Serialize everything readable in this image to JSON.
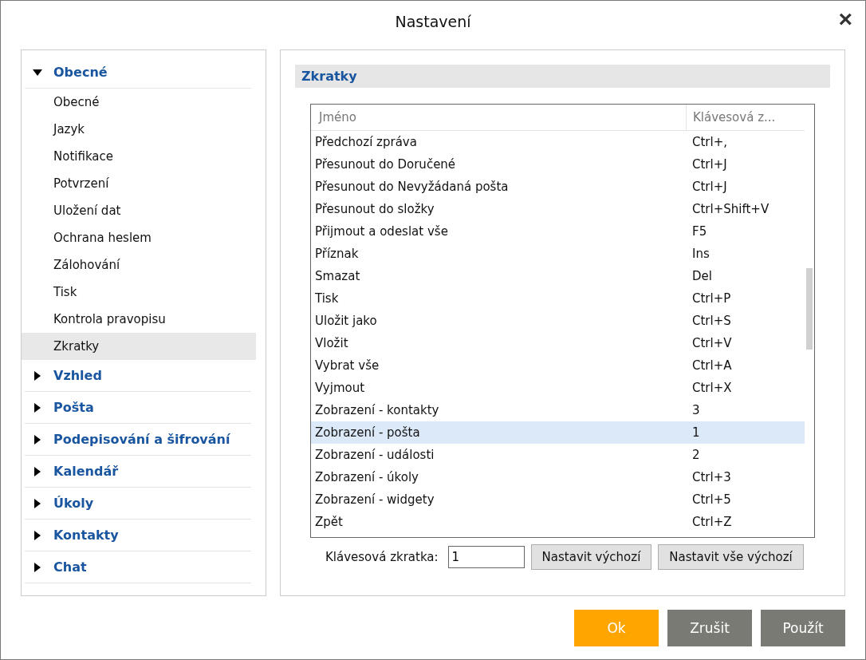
{
  "window": {
    "title": "Nastavení",
    "close": "×"
  },
  "sidebar": {
    "groups": [
      {
        "label": "Obecné",
        "expanded": true,
        "children": [
          {
            "label": "Obecné",
            "selected": false
          },
          {
            "label": "Jazyk",
            "selected": false
          },
          {
            "label": "Notifikace",
            "selected": false
          },
          {
            "label": "Potvrzení",
            "selected": false
          },
          {
            "label": "Uložení dat",
            "selected": false
          },
          {
            "label": "Ochrana heslem",
            "selected": false
          },
          {
            "label": "Zálohování",
            "selected": false
          },
          {
            "label": "Tisk",
            "selected": false
          },
          {
            "label": "Kontrola pravopisu",
            "selected": false
          },
          {
            "label": "Zkratky",
            "selected": true
          }
        ]
      },
      {
        "label": "Vzhled",
        "expanded": false
      },
      {
        "label": "Pošta",
        "expanded": false
      },
      {
        "label": "Podepisování a šifrování",
        "expanded": false
      },
      {
        "label": "Kalendář",
        "expanded": false
      },
      {
        "label": "Úkoly",
        "expanded": false
      },
      {
        "label": "Kontakty",
        "expanded": false
      },
      {
        "label": "Chat",
        "expanded": false
      }
    ]
  },
  "section": {
    "title": "Zkratky"
  },
  "table": {
    "columns": [
      "Jméno",
      "Klávesová z..."
    ],
    "rows": [
      {
        "name": "Předchozí zpráva",
        "key": "Ctrl+,",
        "selected": false
      },
      {
        "name": "Přesunout do Doručené",
        "key": "Ctrl+J",
        "selected": false
      },
      {
        "name": "Přesunout do Nevyžádaná pošta",
        "key": "Ctrl+J",
        "selected": false
      },
      {
        "name": "Přesunout do složky",
        "key": "Ctrl+Shift+V",
        "selected": false
      },
      {
        "name": "Přijmout a odeslat vše",
        "key": "F5",
        "selected": false
      },
      {
        "name": "Příznak",
        "key": "Ins",
        "selected": false
      },
      {
        "name": "Smazat",
        "key": "Del",
        "selected": false
      },
      {
        "name": "Tisk",
        "key": "Ctrl+P",
        "selected": false
      },
      {
        "name": "Uložit jako",
        "key": "Ctrl+S",
        "selected": false
      },
      {
        "name": "Vložit",
        "key": "Ctrl+V",
        "selected": false
      },
      {
        "name": "Vybrat vše",
        "key": "Ctrl+A",
        "selected": false
      },
      {
        "name": "Vyjmout",
        "key": "Ctrl+X",
        "selected": false
      },
      {
        "name": "Zobrazení - kontakty",
        "key": "3",
        "selected": false
      },
      {
        "name": "Zobrazení - pošta",
        "key": "1",
        "selected": true
      },
      {
        "name": "Zobrazení - události",
        "key": "2",
        "selected": false
      },
      {
        "name": "Zobrazení - úkoly",
        "key": "Ctrl+3",
        "selected": false
      },
      {
        "name": "Zobrazení - widgety",
        "key": "Ctrl+5",
        "selected": false
      },
      {
        "name": "Zpět",
        "key": "Ctrl+Z",
        "selected": false
      }
    ]
  },
  "shortcut": {
    "label": "Klávesová zkratka:",
    "value": "1",
    "buttons": [
      "Nastavit výchozí",
      "Nastavit vše výchozí"
    ]
  },
  "footer": [
    {
      "label": "Ok",
      "kind": "primary"
    },
    {
      "label": "Zrušit",
      "kind": "secondary"
    },
    {
      "label": "Použít",
      "kind": "secondary"
    }
  ]
}
